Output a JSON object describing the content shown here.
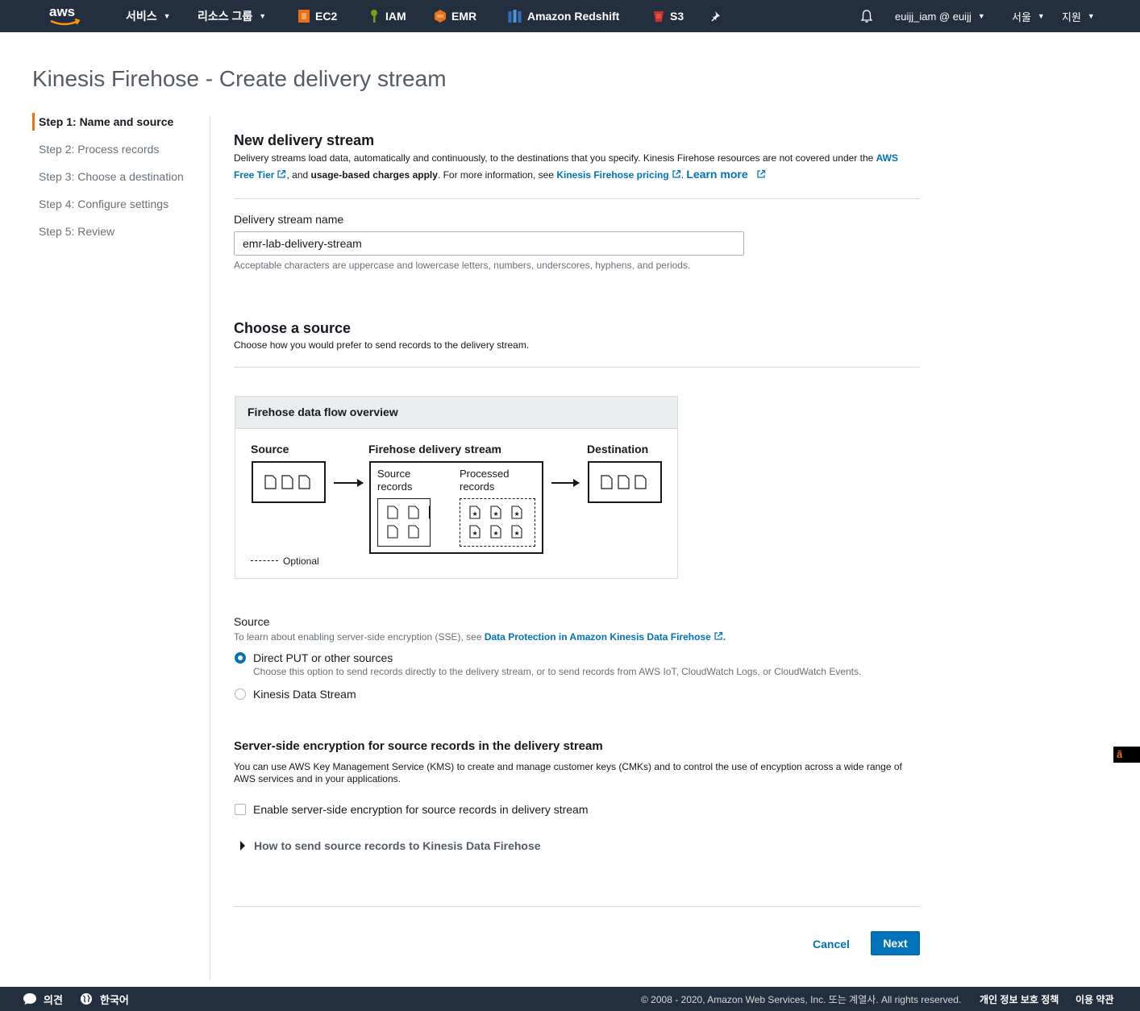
{
  "topnav": {
    "logo": "aws",
    "services": "서비스",
    "resource_groups": "리소스 그룹",
    "shortcuts": [
      {
        "label": "EC2",
        "icon": "ec2-icon",
        "color": "#e7711b"
      },
      {
        "label": "IAM",
        "icon": "iam-icon",
        "color": "#7aa116"
      },
      {
        "label": "EMR",
        "icon": "emr-icon",
        "color": "#e7711b"
      },
      {
        "label": "Amazon Redshift",
        "icon": "redshift-icon",
        "color": "#2e73b8"
      },
      {
        "label": "S3",
        "icon": "s3-icon",
        "color": "#c7322d"
      }
    ],
    "account": "euijj_iam @ euijj",
    "region": "서울",
    "support": "지원"
  },
  "page": {
    "title": "Kinesis Firehose - Create delivery stream"
  },
  "steps": [
    {
      "label": "Step 1: Name and source",
      "active": true
    },
    {
      "label": "Step 2: Process records",
      "active": false
    },
    {
      "label": "Step 3: Choose a destination",
      "active": false
    },
    {
      "label": "Step 4: Configure settings",
      "active": false
    },
    {
      "label": "Step 5: Review",
      "active": false
    }
  ],
  "new_stream": {
    "heading": "New delivery stream",
    "desc_part1": "Delivery streams load data, automatically and continuously, to the destinations that you specify. Kinesis Firehose resources are not covered under the ",
    "free_tier_link_1": "AWS",
    "free_tier_link_2": "Free Tier",
    "desc_part2": ", and ",
    "desc_bold": "usage-based charges apply",
    "desc_part3": ". For more information, see ",
    "pricing_link": "Kinesis Firehose pricing",
    "desc_part4": ". ",
    "learn_more": "Learn more"
  },
  "name_field": {
    "label": "Delivery stream name",
    "value": "emr-lab-delivery-stream",
    "hint": "Acceptable characters are uppercase and lowercase letters, numbers, underscores, hyphens, and periods."
  },
  "choose_source": {
    "heading": "Choose a source",
    "desc": "Choose how you would prefer to send records to the delivery stream."
  },
  "diagram": {
    "header": "Firehose data flow overview",
    "source": "Source",
    "stream": "Firehose delivery stream",
    "destination": "Destination",
    "source_records_1": "Source",
    "source_records_2": "records",
    "processed_records_1": "Processed",
    "processed_records_2": "records",
    "optional": "Optional"
  },
  "source_section": {
    "label": "Source",
    "hint_text": "To learn about enabling server-side encryption (SSE), see ",
    "hint_link": "Data Protection in Amazon Kinesis Data Firehose",
    "hint_end": ".",
    "options": [
      {
        "label": "Direct PUT or other sources",
        "desc": "Choose this option to send records directly to the delivery stream, or to send records from AWS IoT, CloudWatch Logs, or CloudWatch Events.",
        "checked": true
      },
      {
        "label": "Kinesis Data Stream",
        "desc": "",
        "checked": false
      }
    ]
  },
  "sse": {
    "heading": "Server-side encryption for source records in the delivery stream",
    "desc": "You can use AWS Key Management Service (KMS) to create and manage customer keys (CMKs) and to control the use of encyption across a wide range of AWS services and in your applications.",
    "checkbox_label": "Enable server-side encryption for source records in delivery stream",
    "expander": "How to send source records to Kinesis Data Firehose"
  },
  "actions": {
    "cancel": "Cancel",
    "next": "Next"
  },
  "footer": {
    "feedback": "의견",
    "language": "한국어",
    "copyright": "© 2008 - 2020, Amazon Web Services, Inc. 또는 계열사. All rights reserved.",
    "privacy": "개인 정보 보호 정책",
    "terms": "이용 약관"
  },
  "side_badge": "ā",
  "colors": {
    "nav_bg": "#232f3e",
    "accent": "#ec7211",
    "link": "#0073bb",
    "primary_button": "#0073bb"
  }
}
